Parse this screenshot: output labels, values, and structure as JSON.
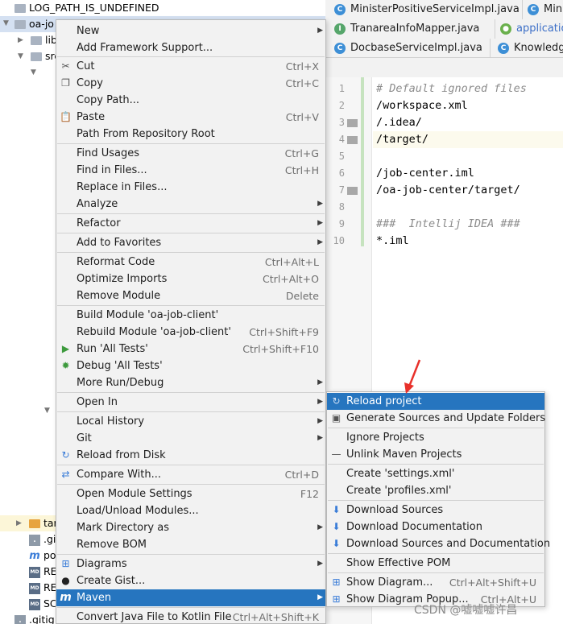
{
  "tree": {
    "rows": [
      "LOG_PATH_IS_UNDEFINED",
      "oa-jo",
      "lib",
      "src",
      "tar",
      ".gi",
      "po",
      "RE",
      "RE",
      "SC",
      ".gitig"
    ]
  },
  "tabs": [
    {
      "label": "MinisterPositiveServiceImpl.java",
      "icon": "C"
    },
    {
      "label": "Minis",
      "icon": "C"
    },
    {
      "label": "TranareaInfoMapper.java",
      "icon": "I"
    },
    {
      "label": "applicatio",
      "icon": "leaf"
    },
    {
      "label": "DocbaseServiceImpl.java",
      "icon": "C"
    },
    {
      "label": "Knowledge",
      "icon": "C"
    }
  ],
  "editor": {
    "lines": [
      {
        "n": "1",
        "text": "# Default ignored files",
        "comment": true
      },
      {
        "n": "2",
        "text": "/workspace.xml",
        "comment": false
      },
      {
        "n": "3",
        "text": "/.idea/",
        "comment": false
      },
      {
        "n": "4",
        "text": "/target/",
        "comment": false
      },
      {
        "n": "5",
        "text": "",
        "comment": false
      },
      {
        "n": "6",
        "text": "/job-center.iml",
        "comment": false
      },
      {
        "n": "7",
        "text": "/oa-job-center/target/",
        "comment": false
      },
      {
        "n": "8",
        "text": "",
        "comment": false
      },
      {
        "n": "9",
        "text": "###  Intellij IDEA ###",
        "comment": true
      },
      {
        "n": "10",
        "text": "*.iml",
        "comment": false
      }
    ]
  },
  "menu": {
    "items": [
      {
        "label": "New",
        "shortcut": "",
        "sub": true,
        "icon": ""
      },
      {
        "label": "Add Framework Support...",
        "shortcut": "",
        "sub": false,
        "icon": ""
      },
      {
        "label": "Cut",
        "shortcut": "Ctrl+X",
        "sub": false,
        "icon": "scissors"
      },
      {
        "label": "Copy",
        "shortcut": "Ctrl+C",
        "sub": false,
        "icon": "copy"
      },
      {
        "label": "Copy Path...",
        "shortcut": "",
        "sub": false,
        "icon": ""
      },
      {
        "label": "Paste",
        "shortcut": "Ctrl+V",
        "sub": false,
        "icon": "paste"
      },
      {
        "label": "Path From Repository Root",
        "shortcut": "",
        "sub": false,
        "icon": ""
      },
      {
        "label": "Find Usages",
        "shortcut": "Ctrl+G",
        "sub": false,
        "icon": ""
      },
      {
        "label": "Find in Files...",
        "shortcut": "Ctrl+H",
        "sub": false,
        "icon": ""
      },
      {
        "label": "Replace in Files...",
        "shortcut": "",
        "sub": false,
        "icon": ""
      },
      {
        "label": "Analyze",
        "shortcut": "",
        "sub": true,
        "icon": ""
      },
      {
        "label": "Refactor",
        "shortcut": "",
        "sub": true,
        "icon": ""
      },
      {
        "label": "Add to Favorites",
        "shortcut": "",
        "sub": true,
        "icon": ""
      },
      {
        "label": "Reformat Code",
        "shortcut": "Ctrl+Alt+L",
        "sub": false,
        "icon": ""
      },
      {
        "label": "Optimize Imports",
        "shortcut": "Ctrl+Alt+O",
        "sub": false,
        "icon": ""
      },
      {
        "label": "Remove Module",
        "shortcut": "Delete",
        "sub": false,
        "icon": ""
      },
      {
        "label": "Build Module 'oa-job-client'",
        "shortcut": "",
        "sub": false,
        "icon": ""
      },
      {
        "label": "Rebuild Module 'oa-job-client'",
        "shortcut": "Ctrl+Shift+F9",
        "sub": false,
        "icon": ""
      },
      {
        "label": "Run 'All Tests'",
        "shortcut": "Ctrl+Shift+F10",
        "sub": false,
        "icon": "run"
      },
      {
        "label": "Debug 'All Tests'",
        "shortcut": "",
        "sub": false,
        "icon": "debug"
      },
      {
        "label": "More Run/Debug",
        "shortcut": "",
        "sub": true,
        "icon": ""
      },
      {
        "label": "Open In",
        "shortcut": "",
        "sub": true,
        "icon": ""
      },
      {
        "label": "Local History",
        "shortcut": "",
        "sub": true,
        "icon": ""
      },
      {
        "label": "Git",
        "shortcut": "",
        "sub": true,
        "icon": ""
      },
      {
        "label": "Reload from Disk",
        "shortcut": "",
        "sub": false,
        "icon": "reload"
      },
      {
        "label": "Compare With...",
        "shortcut": "Ctrl+D",
        "sub": false,
        "icon": "compare"
      },
      {
        "label": "Open Module Settings",
        "shortcut": "F12",
        "sub": false,
        "icon": ""
      },
      {
        "label": "Load/Unload Modules...",
        "shortcut": "",
        "sub": false,
        "icon": ""
      },
      {
        "label": "Mark Directory as",
        "shortcut": "",
        "sub": true,
        "icon": ""
      },
      {
        "label": "Remove BOM",
        "shortcut": "",
        "sub": false,
        "icon": ""
      },
      {
        "label": "Diagrams",
        "shortcut": "",
        "sub": true,
        "icon": "diagram"
      },
      {
        "label": "Create Gist...",
        "shortcut": "",
        "sub": false,
        "icon": "github"
      },
      {
        "label": "Maven",
        "shortcut": "",
        "sub": true,
        "icon": "maven",
        "selected": true
      },
      {
        "label": "Convert Java File to Kotlin File",
        "shortcut": "Ctrl+Alt+Shift+K",
        "sub": false,
        "icon": ""
      }
    ]
  },
  "submenu": {
    "items": [
      {
        "label": "Reload project",
        "shortcut": "",
        "icon": "reload",
        "selected": true
      },
      {
        "label": "Generate Sources and Update Folders",
        "shortcut": "",
        "icon": "generate"
      },
      {
        "label": "Ignore Projects",
        "shortcut": "",
        "icon": ""
      },
      {
        "label": "Unlink Maven Projects",
        "shortcut": "",
        "icon": "minus"
      },
      {
        "label": "Create 'settings.xml'",
        "shortcut": "",
        "icon": ""
      },
      {
        "label": "Create 'profiles.xml'",
        "shortcut": "",
        "icon": ""
      },
      {
        "label": "Download Sources",
        "shortcut": "",
        "icon": "download"
      },
      {
        "label": "Download Documentation",
        "shortcut": "",
        "icon": "download"
      },
      {
        "label": "Download Sources and Documentation",
        "shortcut": "",
        "icon": "download"
      },
      {
        "label": "Show Effective POM",
        "shortcut": "",
        "icon": ""
      },
      {
        "label": "Show Diagram...",
        "shortcut": "Ctrl+Alt+Shift+U",
        "icon": "diagram"
      },
      {
        "label": "Show Diagram Popup...",
        "shortcut": "Ctrl+Alt+U",
        "icon": "diagram"
      }
    ]
  },
  "watermark": "CSDN @嘘嘘嘘许昌",
  "colors": {
    "selection": "#2675bf",
    "annotation_arrow": "#e8302a"
  }
}
